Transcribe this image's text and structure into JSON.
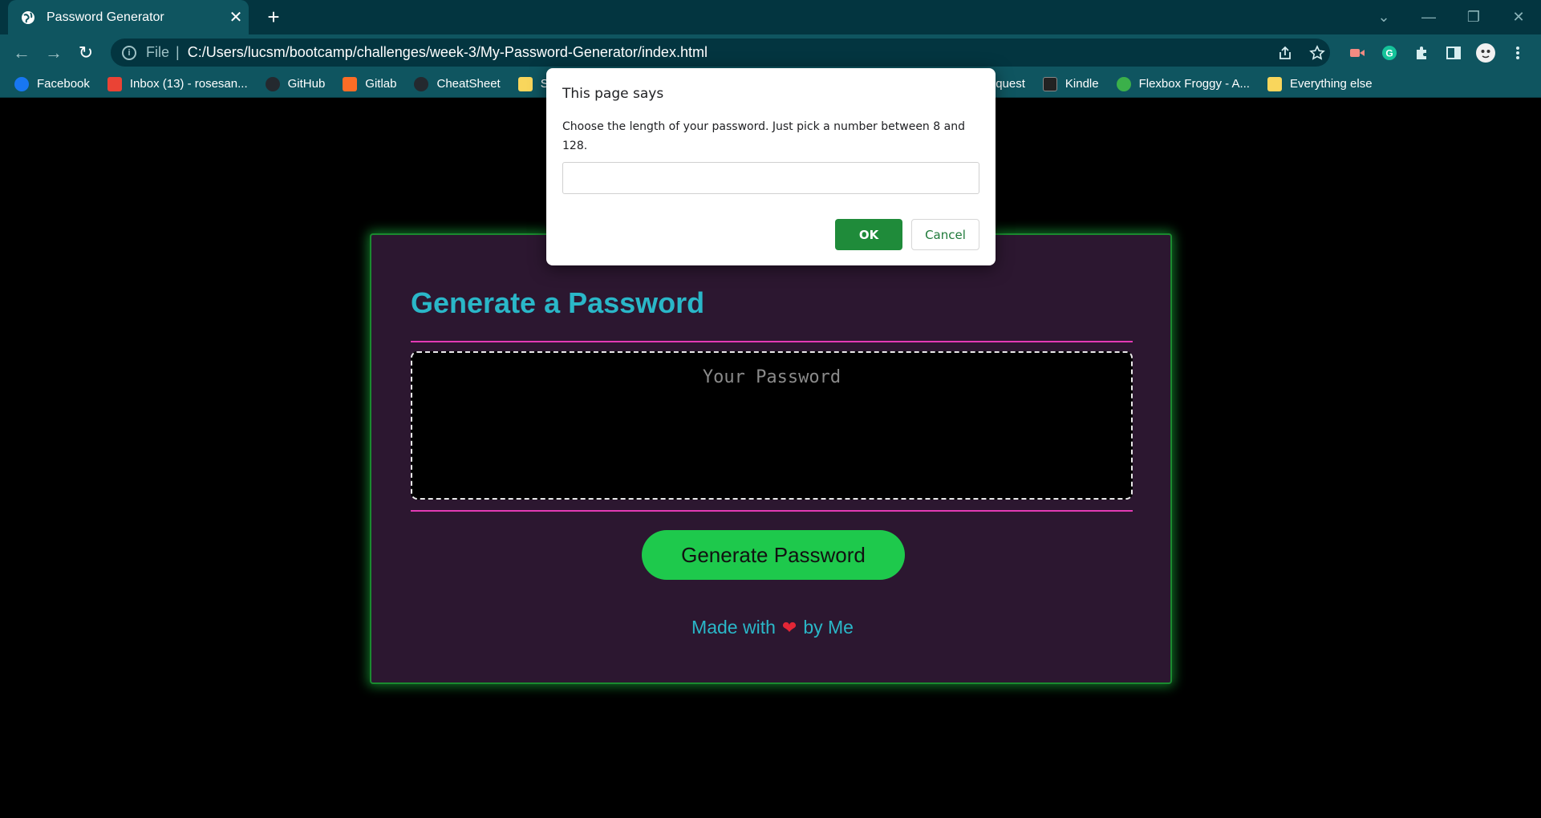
{
  "tab": {
    "title": "Password Generator",
    "close": "✕",
    "new_tab": "+"
  },
  "window_controls": {
    "dropdown": "⌄",
    "minimize": "—",
    "restore": "❐",
    "close": "✕"
  },
  "toolbar": {
    "back": "←",
    "forward": "→",
    "reload": "↻",
    "scheme": "File",
    "separator": "|",
    "url": "C:/Users/lucsm/bootcamp/challenges/week-3/My-Password-Generator/index.html"
  },
  "bookmarks": [
    {
      "label": "Facebook",
      "color": "#1877f2"
    },
    {
      "label": "Inbox (13) - rosesan...",
      "color": "#ea4335"
    },
    {
      "label": "GitHub",
      "color": "#24292f"
    },
    {
      "label": "Gitlab",
      "color": "#fc6d26"
    },
    {
      "label": "CheatSheet",
      "color": "#24292f"
    },
    {
      "label": "Sc",
      "color": "#f9d65c"
    },
    {
      "label": "Tutor request",
      "color": "#1a73e8"
    },
    {
      "label": "Kindle",
      "color": "#222222"
    },
    {
      "label": "Flexbox Froggy - A...",
      "color": "#3bb04a"
    },
    {
      "label": "Everything else",
      "color": "#f9d65c"
    }
  ],
  "card": {
    "title": "Generate a Password",
    "password_placeholder": "Your Password",
    "button": "Generate Password",
    "footer_prefix": "Made with",
    "footer_heart": "❤",
    "footer_suffix": "by Me"
  },
  "dialog": {
    "title": "This page says",
    "message": "Choose the length of your password. Just pick a number between 8 and 128.",
    "input_value": "",
    "ok": "OK",
    "cancel": "Cancel"
  },
  "colors": {
    "accent_teal": "#2ab7c8",
    "button_green": "#1ec94c",
    "rule_pink": "#e33ab4",
    "card_bg": "#2c1730",
    "ok_green": "#1f8b3a"
  }
}
